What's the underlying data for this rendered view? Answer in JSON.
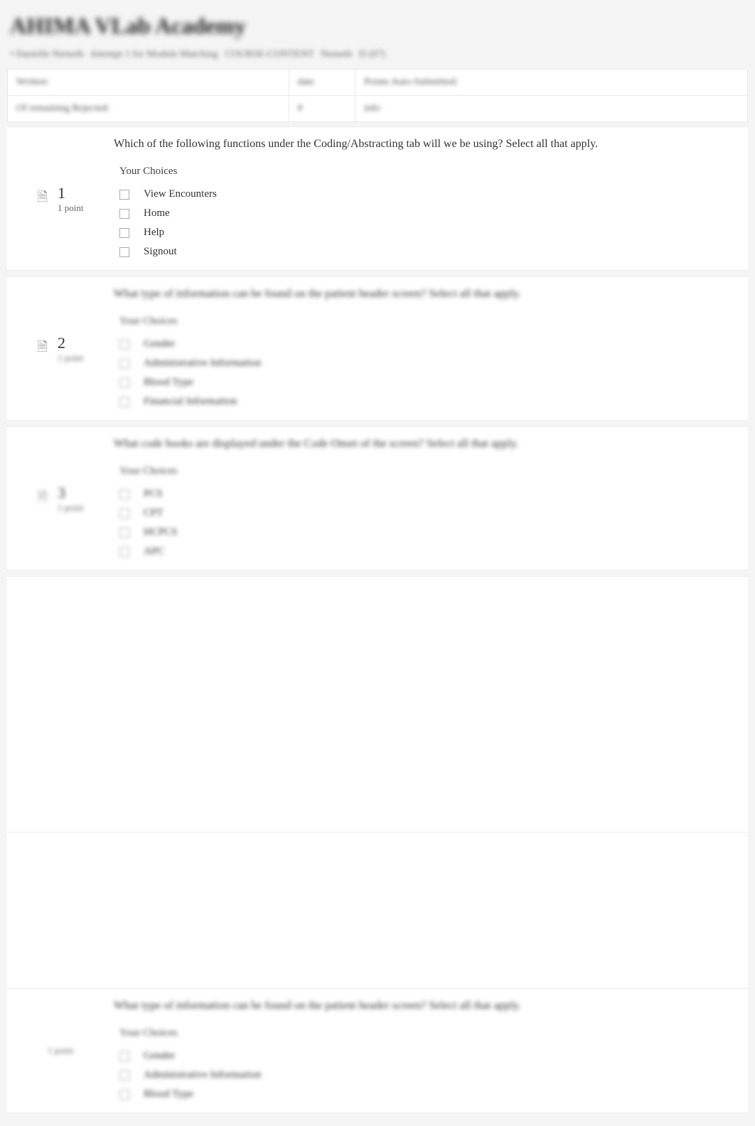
{
  "page": {
    "title": "AHIMA VLab Academy"
  },
  "breadcrumb": {
    "parts": [
      "• Danielle Nemeth",
      "Attempt 1 for Module Matching",
      "COURSE-CONTENT",
      "Nemeth",
      "D (07)"
    ]
  },
  "info_rows": [
    {
      "c1": "Written:",
      "c2": "date",
      "c3": "Points Auto-Submitted:"
    },
    {
      "c1": "Of remaining Rejected:",
      "c2": "#",
      "c3": "info"
    }
  ],
  "questions": [
    {
      "number": "1",
      "points": "1 point",
      "blurred": false,
      "text": "Which of the following functions under the Coding/Abstracting tab will we be using? Select all that apply.",
      "choices_label": "Your Choices",
      "choices": [
        "View Encounters",
        "Home",
        "Help",
        "Signout"
      ]
    },
    {
      "number": "2",
      "points": "1 point",
      "blurred": true,
      "text": "What type of information can be found on the patient header screen? Select all that apply.",
      "choices_label": "Your Choices",
      "choices": [
        "Gender",
        "Administrative Information",
        "Blood Type",
        "Financial Information"
      ]
    },
    {
      "number": "3",
      "points": "1 point",
      "blurred": true,
      "text": "What code books are displayed under the Code Onset of the screen? Select all that apply.",
      "choices_label": "Your Choices",
      "choices": [
        "PCS",
        "CPT",
        "HCPCS",
        "APC"
      ]
    }
  ],
  "repeat_question": {
    "number": "",
    "points": "1 point",
    "blurred": true,
    "text": "What type of information can be found on the patient header screen? Select all that apply.",
    "choices_label": "Your Choices",
    "choices": [
      "Gender",
      "Administrative Information",
      "Blood Type"
    ]
  }
}
